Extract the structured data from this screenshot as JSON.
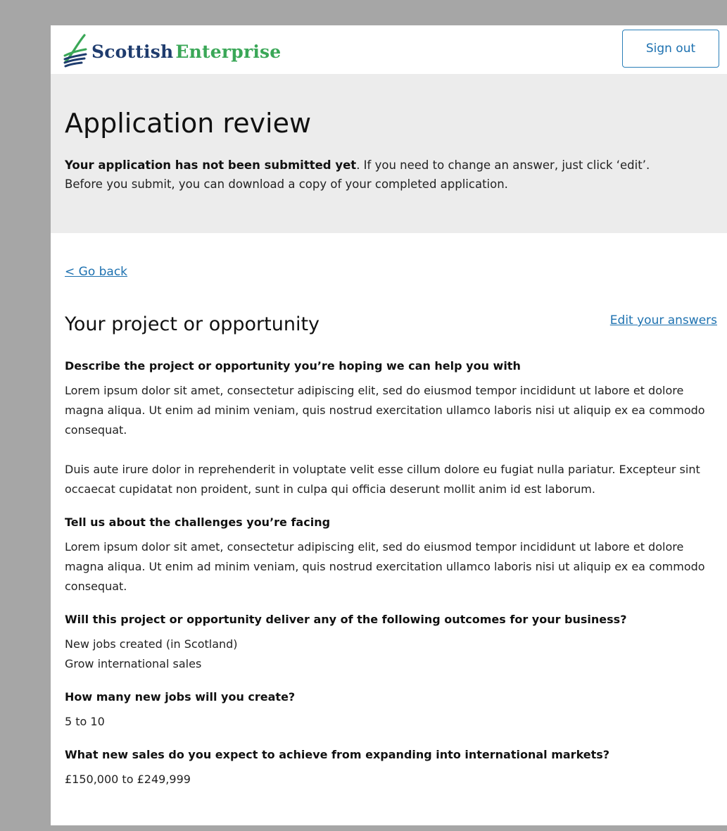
{
  "header": {
    "logo_word1": "Scottish",
    "logo_word2": "Enterprise",
    "signout_label": "Sign out"
  },
  "banner": {
    "title": "Application review",
    "notice_bold": "Your application has not been submitted yet",
    "notice_rest": ". If you need to change an answer, just click ‘edit’.",
    "notice_line2": "Before you submit, you can download a copy of your completed application."
  },
  "main": {
    "go_back": "< Go back",
    "section_title": "Your project or opportunity",
    "edit_link": "Edit your answers",
    "questions": [
      {
        "q": "Describe the project or opportunity you’re hoping we can help you with",
        "a1": "Lorem ipsum dolor sit amet, consectetur adipiscing elit, sed do eiusmod tempor incididunt ut labore et dolore magna aliqua. Ut enim ad minim veniam, quis nostrud exercitation ullamco laboris nisi ut aliquip ex ea commodo consequat.",
        "a2": "Duis aute irure dolor in reprehenderit in voluptate velit esse cillum dolore eu fugiat nulla pariatur. Excepteur sint occaecat cupidatat non proident, sunt in culpa qui officia deserunt mollit anim id est laborum."
      },
      {
        "q": "Tell us about the challenges you’re facing",
        "a1": "Lorem ipsum dolor sit amet, consectetur adipiscing elit, sed do eiusmod tempor incididunt ut labore et dolore magna aliqua. Ut enim ad minim veniam, quis nostrud exercitation ullamco laboris nisi ut aliquip ex ea commodo consequat."
      },
      {
        "q": "Will this project or opportunity deliver any of the following outcomes for your business?",
        "a1": "New jobs created (in Scotland)",
        "a2": "Grow international sales"
      },
      {
        "q": "How many new jobs will you create?",
        "a1": "5 to 10"
      },
      {
        "q": "What new sales do you expect to achieve from expanding into international markets?",
        "a1": "£150,000 to £249,999"
      }
    ]
  },
  "colors": {
    "link": "#1d71b0",
    "banner_bg": "#ececec",
    "logo_blue": "#1f3c6e",
    "logo_green": "#3aa757"
  }
}
